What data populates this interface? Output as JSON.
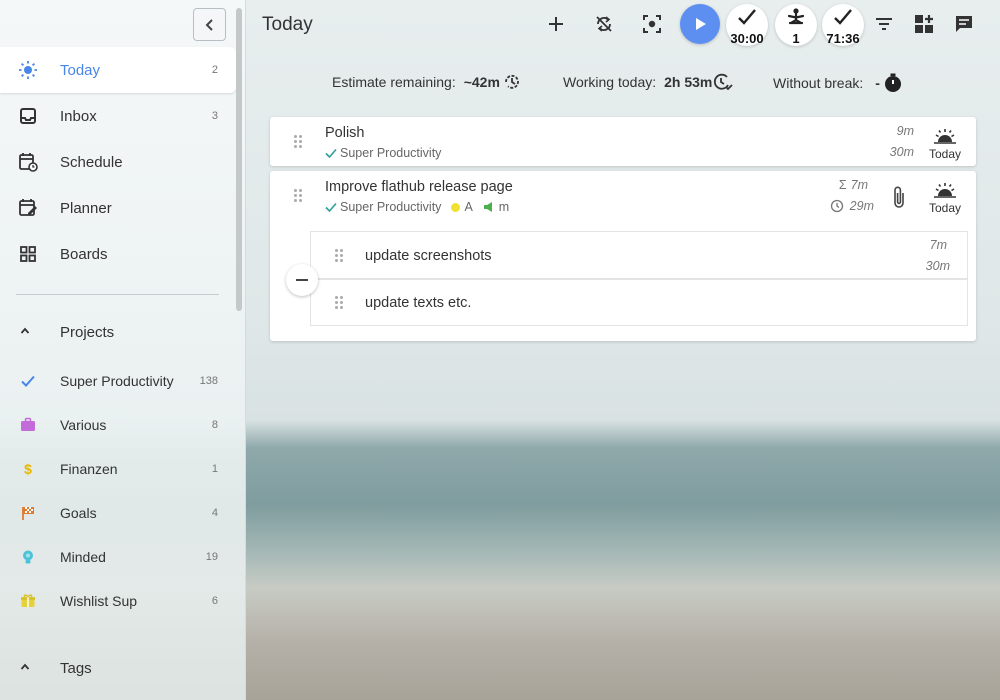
{
  "header": {
    "title": "Today",
    "pomodoro_timer": "30:00",
    "focus_count": "1",
    "tracking_time": "71:36"
  },
  "metrics": {
    "estimate_label": "Estimate remaining:",
    "estimate_value": "~42m",
    "working_label": "Working today:",
    "working_value": "2h 53m",
    "break_label": "Without break:",
    "break_value": "-"
  },
  "sidebar": {
    "nav": [
      {
        "label": "Today",
        "count": "2",
        "icon": "sun-icon"
      },
      {
        "label": "Inbox",
        "count": "3",
        "icon": "inbox-icon"
      },
      {
        "label": "Schedule",
        "count": "",
        "icon": "calendar-clock-icon"
      },
      {
        "label": "Planner",
        "count": "",
        "icon": "calendar-edit-icon"
      },
      {
        "label": "Boards",
        "count": "",
        "icon": "grid-icon"
      }
    ],
    "projects_label": "Projects",
    "projects": [
      {
        "label": "Super Productivity",
        "count": "138",
        "icon": "check-icon",
        "color": "#4a86e8"
      },
      {
        "label": "Various",
        "count": "8",
        "icon": "briefcase-icon",
        "color": "#c36bd8"
      },
      {
        "label": "Finanzen",
        "count": "1",
        "icon": "dollar-icon",
        "color": "#e6b800"
      },
      {
        "label": "Goals",
        "count": "4",
        "icon": "flag-icon",
        "color": "#e07a2e"
      },
      {
        "label": "Minded",
        "count": "19",
        "icon": "lightbulb-icon",
        "color": "#4cc3d9"
      },
      {
        "label": "Wishlist Sup",
        "count": "6",
        "icon": "gift-icon",
        "color": "#e6d13a"
      }
    ],
    "tags_label": "Tags"
  },
  "tasks": [
    {
      "title": "Polish",
      "project": "Super Productivity",
      "time_spent": "9m",
      "time_estimate": "30m",
      "today_label": "Today"
    },
    {
      "title": "Improve flathub release page",
      "project": "Super Productivity",
      "tag_a": "A",
      "tag_m": "m",
      "time_spent": "7m",
      "time_estimate": "29m",
      "today_label": "Today",
      "subtasks": [
        {
          "title": "update screenshots",
          "time_spent": "7m",
          "time_estimate": "30m"
        },
        {
          "title": "update texts etc.",
          "time_spent": "",
          "time_estimate": ""
        }
      ]
    }
  ],
  "colors": {
    "accent": "#4a86e8",
    "play_button": "#5c8ff0",
    "project_check": "#2e9e96",
    "tag_a": "#f0e030",
    "tag_m": "#4caf50"
  }
}
